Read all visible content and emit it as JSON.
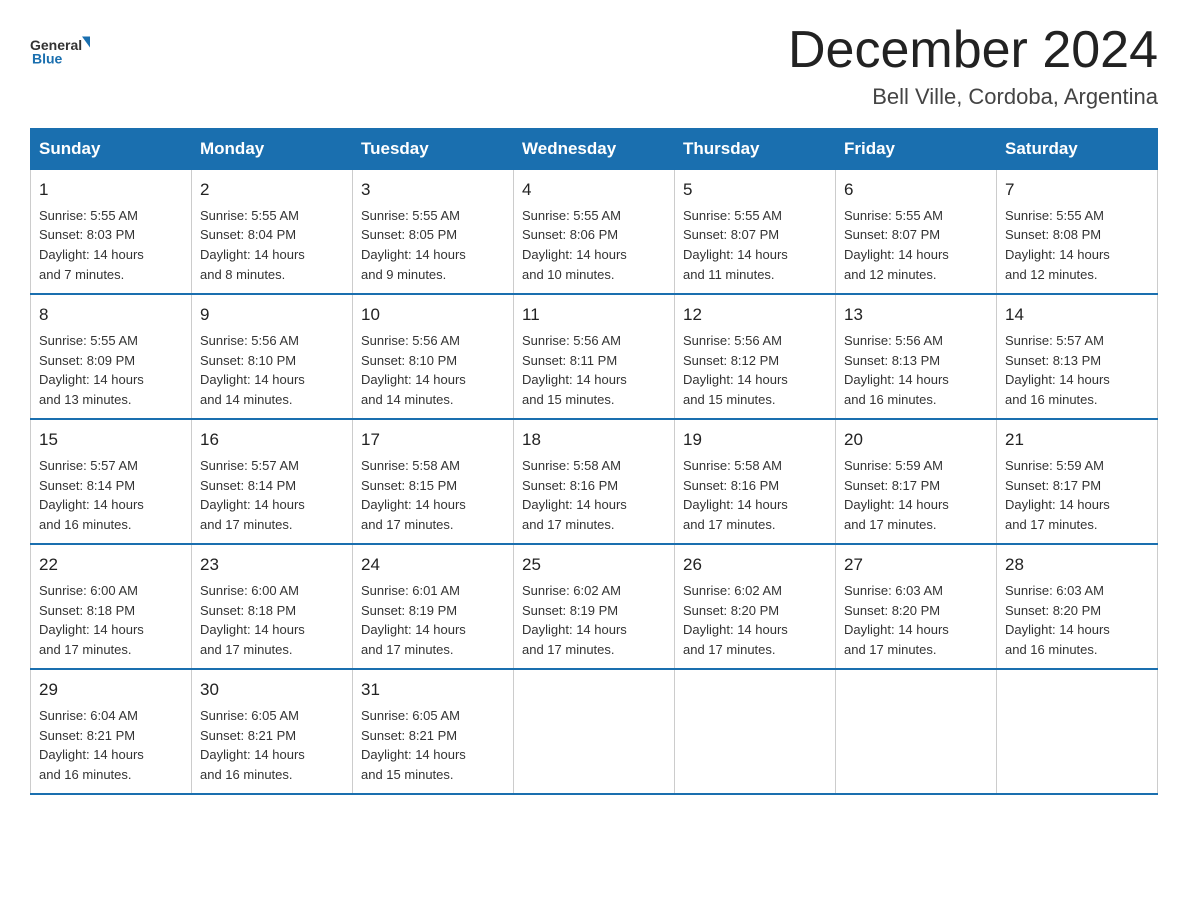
{
  "header": {
    "logo_text_general": "General",
    "logo_text_blue": "Blue",
    "title": "December 2024",
    "subtitle": "Bell Ville, Cordoba, Argentina"
  },
  "days_of_week": [
    "Sunday",
    "Monday",
    "Tuesday",
    "Wednesday",
    "Thursday",
    "Friday",
    "Saturday"
  ],
  "weeks": [
    [
      {
        "day": "1",
        "sunrise": "5:55 AM",
        "sunset": "8:03 PM",
        "daylight": "14 hours and 7 minutes."
      },
      {
        "day": "2",
        "sunrise": "5:55 AM",
        "sunset": "8:04 PM",
        "daylight": "14 hours and 8 minutes."
      },
      {
        "day": "3",
        "sunrise": "5:55 AM",
        "sunset": "8:05 PM",
        "daylight": "14 hours and 9 minutes."
      },
      {
        "day": "4",
        "sunrise": "5:55 AM",
        "sunset": "8:06 PM",
        "daylight": "14 hours and 10 minutes."
      },
      {
        "day": "5",
        "sunrise": "5:55 AM",
        "sunset": "8:07 PM",
        "daylight": "14 hours and 11 minutes."
      },
      {
        "day": "6",
        "sunrise": "5:55 AM",
        "sunset": "8:07 PM",
        "daylight": "14 hours and 12 minutes."
      },
      {
        "day": "7",
        "sunrise": "5:55 AM",
        "sunset": "8:08 PM",
        "daylight": "14 hours and 12 minutes."
      }
    ],
    [
      {
        "day": "8",
        "sunrise": "5:55 AM",
        "sunset": "8:09 PM",
        "daylight": "14 hours and 13 minutes."
      },
      {
        "day": "9",
        "sunrise": "5:56 AM",
        "sunset": "8:10 PM",
        "daylight": "14 hours and 14 minutes."
      },
      {
        "day": "10",
        "sunrise": "5:56 AM",
        "sunset": "8:10 PM",
        "daylight": "14 hours and 14 minutes."
      },
      {
        "day": "11",
        "sunrise": "5:56 AM",
        "sunset": "8:11 PM",
        "daylight": "14 hours and 15 minutes."
      },
      {
        "day": "12",
        "sunrise": "5:56 AM",
        "sunset": "8:12 PM",
        "daylight": "14 hours and 15 minutes."
      },
      {
        "day": "13",
        "sunrise": "5:56 AM",
        "sunset": "8:13 PM",
        "daylight": "14 hours and 16 minutes."
      },
      {
        "day": "14",
        "sunrise": "5:57 AM",
        "sunset": "8:13 PM",
        "daylight": "14 hours and 16 minutes."
      }
    ],
    [
      {
        "day": "15",
        "sunrise": "5:57 AM",
        "sunset": "8:14 PM",
        "daylight": "14 hours and 16 minutes."
      },
      {
        "day": "16",
        "sunrise": "5:57 AM",
        "sunset": "8:14 PM",
        "daylight": "14 hours and 17 minutes."
      },
      {
        "day": "17",
        "sunrise": "5:58 AM",
        "sunset": "8:15 PM",
        "daylight": "14 hours and 17 minutes."
      },
      {
        "day": "18",
        "sunrise": "5:58 AM",
        "sunset": "8:16 PM",
        "daylight": "14 hours and 17 minutes."
      },
      {
        "day": "19",
        "sunrise": "5:58 AM",
        "sunset": "8:16 PM",
        "daylight": "14 hours and 17 minutes."
      },
      {
        "day": "20",
        "sunrise": "5:59 AM",
        "sunset": "8:17 PM",
        "daylight": "14 hours and 17 minutes."
      },
      {
        "day": "21",
        "sunrise": "5:59 AM",
        "sunset": "8:17 PM",
        "daylight": "14 hours and 17 minutes."
      }
    ],
    [
      {
        "day": "22",
        "sunrise": "6:00 AM",
        "sunset": "8:18 PM",
        "daylight": "14 hours and 17 minutes."
      },
      {
        "day": "23",
        "sunrise": "6:00 AM",
        "sunset": "8:18 PM",
        "daylight": "14 hours and 17 minutes."
      },
      {
        "day": "24",
        "sunrise": "6:01 AM",
        "sunset": "8:19 PM",
        "daylight": "14 hours and 17 minutes."
      },
      {
        "day": "25",
        "sunrise": "6:02 AM",
        "sunset": "8:19 PM",
        "daylight": "14 hours and 17 minutes."
      },
      {
        "day": "26",
        "sunrise": "6:02 AM",
        "sunset": "8:20 PM",
        "daylight": "14 hours and 17 minutes."
      },
      {
        "day": "27",
        "sunrise": "6:03 AM",
        "sunset": "8:20 PM",
        "daylight": "14 hours and 17 minutes."
      },
      {
        "day": "28",
        "sunrise": "6:03 AM",
        "sunset": "8:20 PM",
        "daylight": "14 hours and 16 minutes."
      }
    ],
    [
      {
        "day": "29",
        "sunrise": "6:04 AM",
        "sunset": "8:21 PM",
        "daylight": "14 hours and 16 minutes."
      },
      {
        "day": "30",
        "sunrise": "6:05 AM",
        "sunset": "8:21 PM",
        "daylight": "14 hours and 16 minutes."
      },
      {
        "day": "31",
        "sunrise": "6:05 AM",
        "sunset": "8:21 PM",
        "daylight": "14 hours and 15 minutes."
      },
      null,
      null,
      null,
      null
    ]
  ],
  "labels": {
    "sunrise": "Sunrise:",
    "sunset": "Sunset:",
    "daylight": "Daylight:"
  }
}
